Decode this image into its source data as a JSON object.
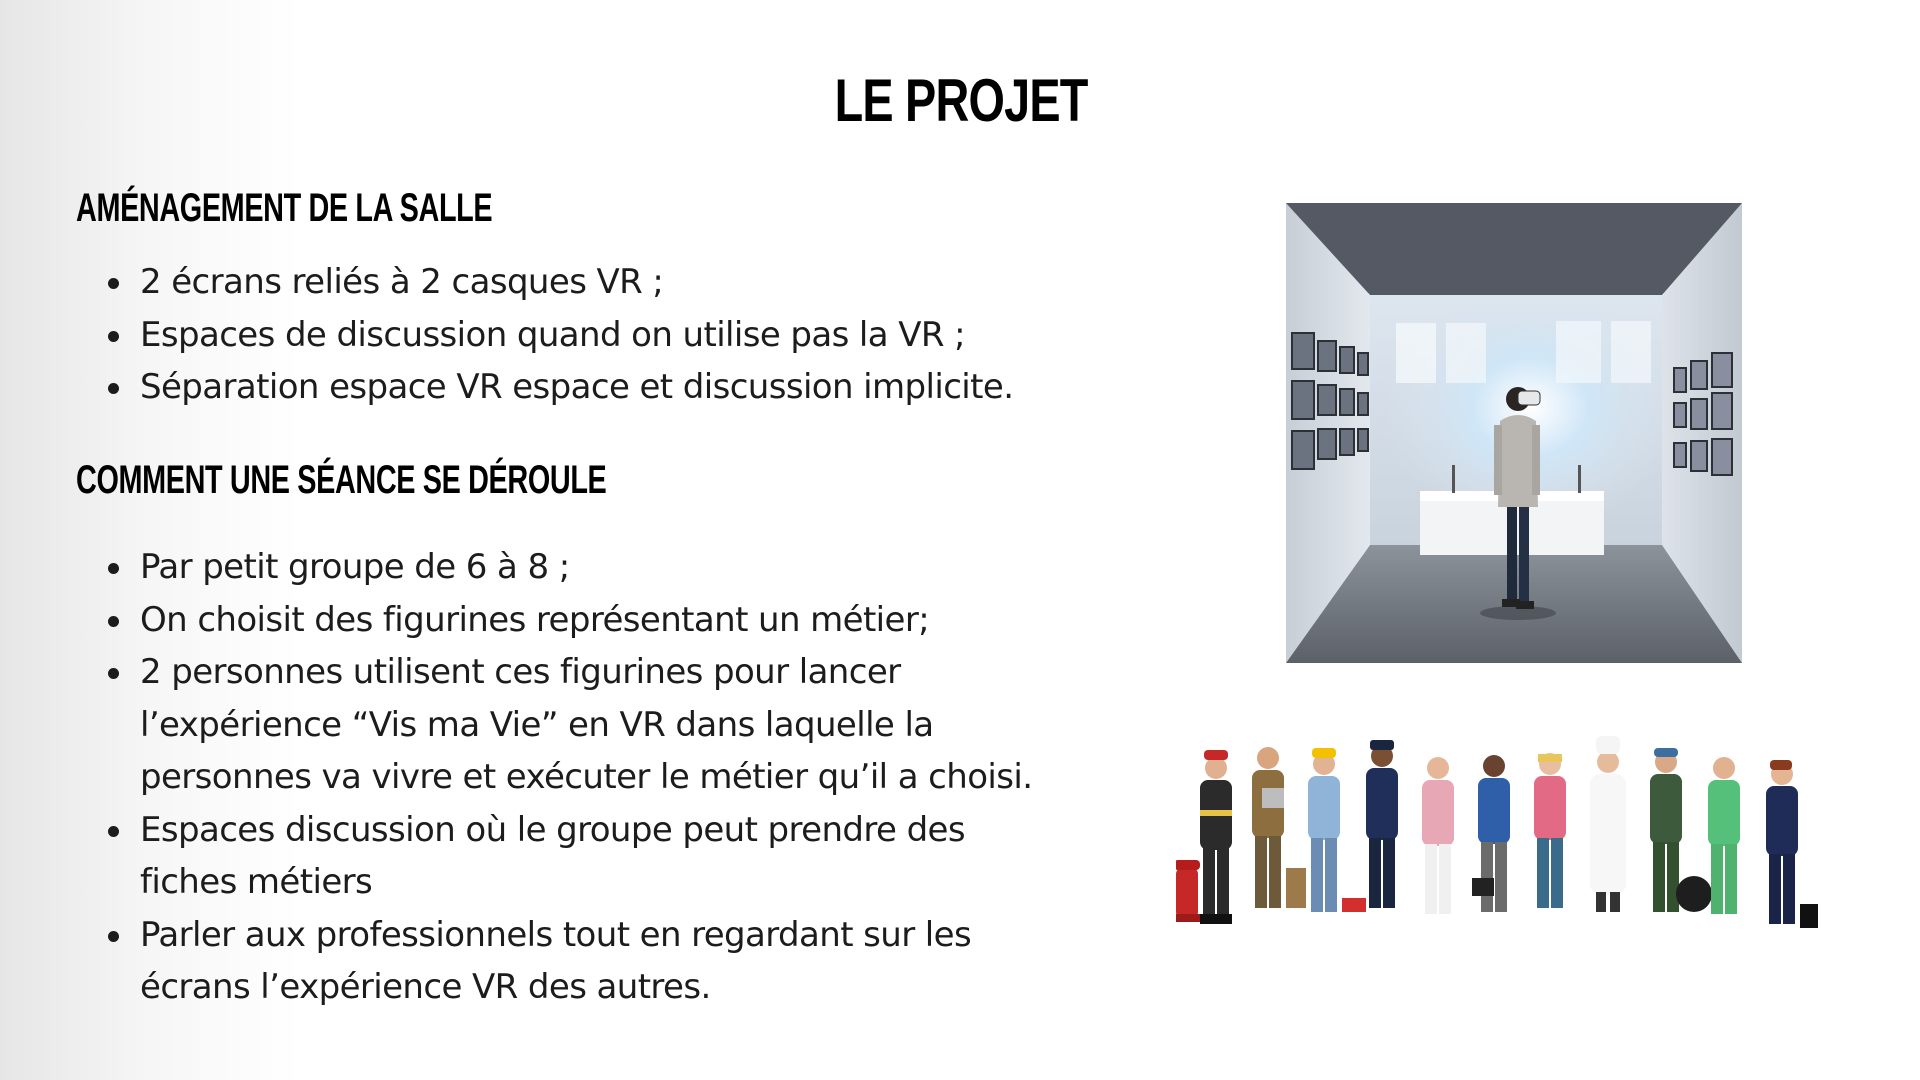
{
  "slide": {
    "title": "LE PROJET"
  },
  "section1": {
    "heading": "AMÉNAGEMENT DE LA SALLE",
    "items": [
      "2 écrans reliés à 2 casques VR ;",
      "Espaces de discussion quand on utilise pas la VR ;",
      "Séparation espace VR espace et discussion implicite."
    ]
  },
  "section2": {
    "heading": "COMMENT UNE SÉANCE SE DÉROULE",
    "items": [
      {
        "lines": [
          "Par petit groupe de 6 à 8 ;"
        ]
      },
      {
        "lines": [
          "On choisit des figurines représentant un métier;"
        ]
      },
      {
        "lines": [
          "2 personnes utilisent ces figurines pour lancer",
          "l’expérience “Vis ma Vie” en VR dans laquelle la",
          "personnes va vivre et exécuter le métier qu’il a choisi."
        ]
      },
      {
        "lines": [
          "Espaces discussion où le groupe peut prendre des",
          "fiches métiers"
        ]
      },
      {
        "lines": [
          "Parler aux professionnels tout en regardant sur les",
          "écrans l’expérience VR des autres."
        ]
      }
    ]
  },
  "images": {
    "vr_room": "person-wearing-vr-headset-in-gallery-room",
    "figurines": "job-figurines-group"
  }
}
